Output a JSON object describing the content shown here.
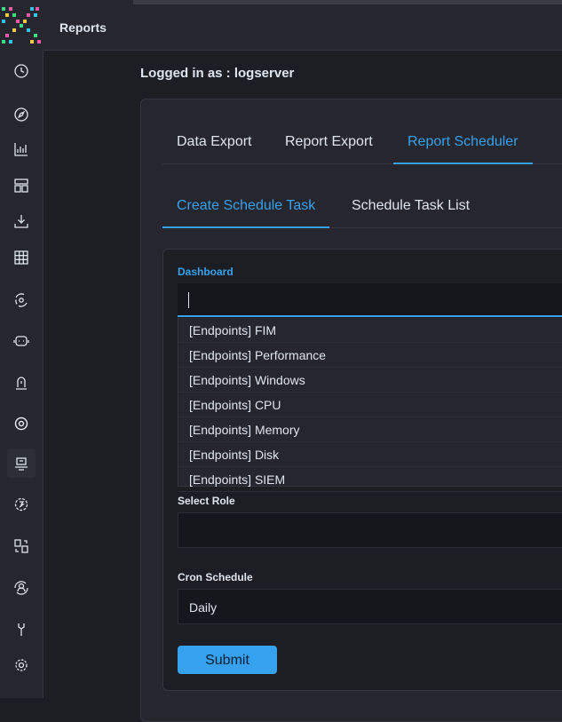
{
  "header": {
    "app_title": "Reports"
  },
  "sidebar": {
    "items": [
      {
        "icon": "clock-icon"
      },
      {
        "icon": "compass-icon"
      },
      {
        "icon": "chart-icon"
      },
      {
        "icon": "dashboard-icon"
      },
      {
        "icon": "download-icon"
      },
      {
        "icon": "grid-icon"
      },
      {
        "icon": "network-icon"
      },
      {
        "icon": "robot-icon"
      },
      {
        "icon": "alert-icon"
      },
      {
        "icon": "gear-badge-icon"
      },
      {
        "icon": "scheduler-icon",
        "active": true
      },
      {
        "icon": "cycle-icon"
      },
      {
        "icon": "transfer-icon"
      },
      {
        "icon": "user-sync-icon"
      },
      {
        "icon": "wrench-icon"
      },
      {
        "icon": "settings-icon"
      }
    ]
  },
  "page": {
    "login_text": "Logged in as : logserver"
  },
  "tabs_primary": {
    "data_export": "Data Export",
    "report_export": "Report Export",
    "report_scheduler": "Report Scheduler"
  },
  "tabs_secondary": {
    "create": "Create Schedule Task",
    "list": "Schedule Task List"
  },
  "form": {
    "dashboard_label": "Dashboard",
    "dashboard_value": "",
    "dashboard_options": [
      "[Endpoints] FIM",
      "[Endpoints] Performance",
      "[Endpoints] Windows",
      "[Endpoints] CPU",
      "[Endpoints] Memory",
      "[Endpoints] Disk",
      "[Endpoints] SIEM"
    ],
    "role_label": "Select Role",
    "role_value": "",
    "cron_label": "Cron Schedule",
    "cron_value": "Daily",
    "submit_label": "Submit"
  },
  "colors": {
    "accent": "#36a2ef",
    "background": "#1d1e24",
    "panel": "#25262e"
  }
}
